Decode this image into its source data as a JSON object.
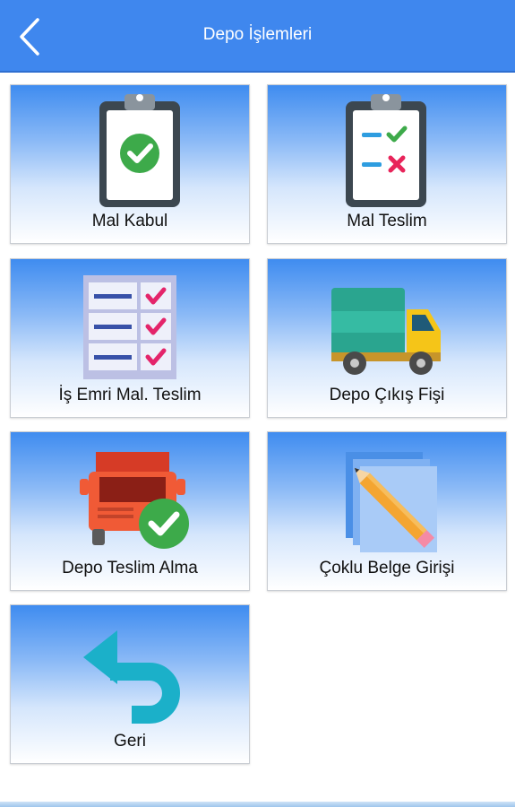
{
  "header": {
    "title": "Depo İşlemleri"
  },
  "tiles": [
    {
      "label": "Mal Kabul",
      "icon": "clipboard-check-icon"
    },
    {
      "label": "Mal Teslim",
      "icon": "clipboard-checklist-icon"
    },
    {
      "label": "İş Emri Mal. Teslim",
      "icon": "checklist-icon"
    },
    {
      "label": "Depo Çıkış Fişi",
      "icon": "delivery-truck-icon"
    },
    {
      "label": "Depo Teslim Alma",
      "icon": "truck-check-icon"
    },
    {
      "label": "Çoklu Belge Girişi",
      "icon": "documents-pencil-icon"
    },
    {
      "label": "Geri",
      "icon": "undo-arrow-icon"
    }
  ],
  "colors": {
    "header": "#3f87ee",
    "check_green": "#3daa4a",
    "cross_red": "#e8245a",
    "tile_top": "#3f8cf0"
  }
}
